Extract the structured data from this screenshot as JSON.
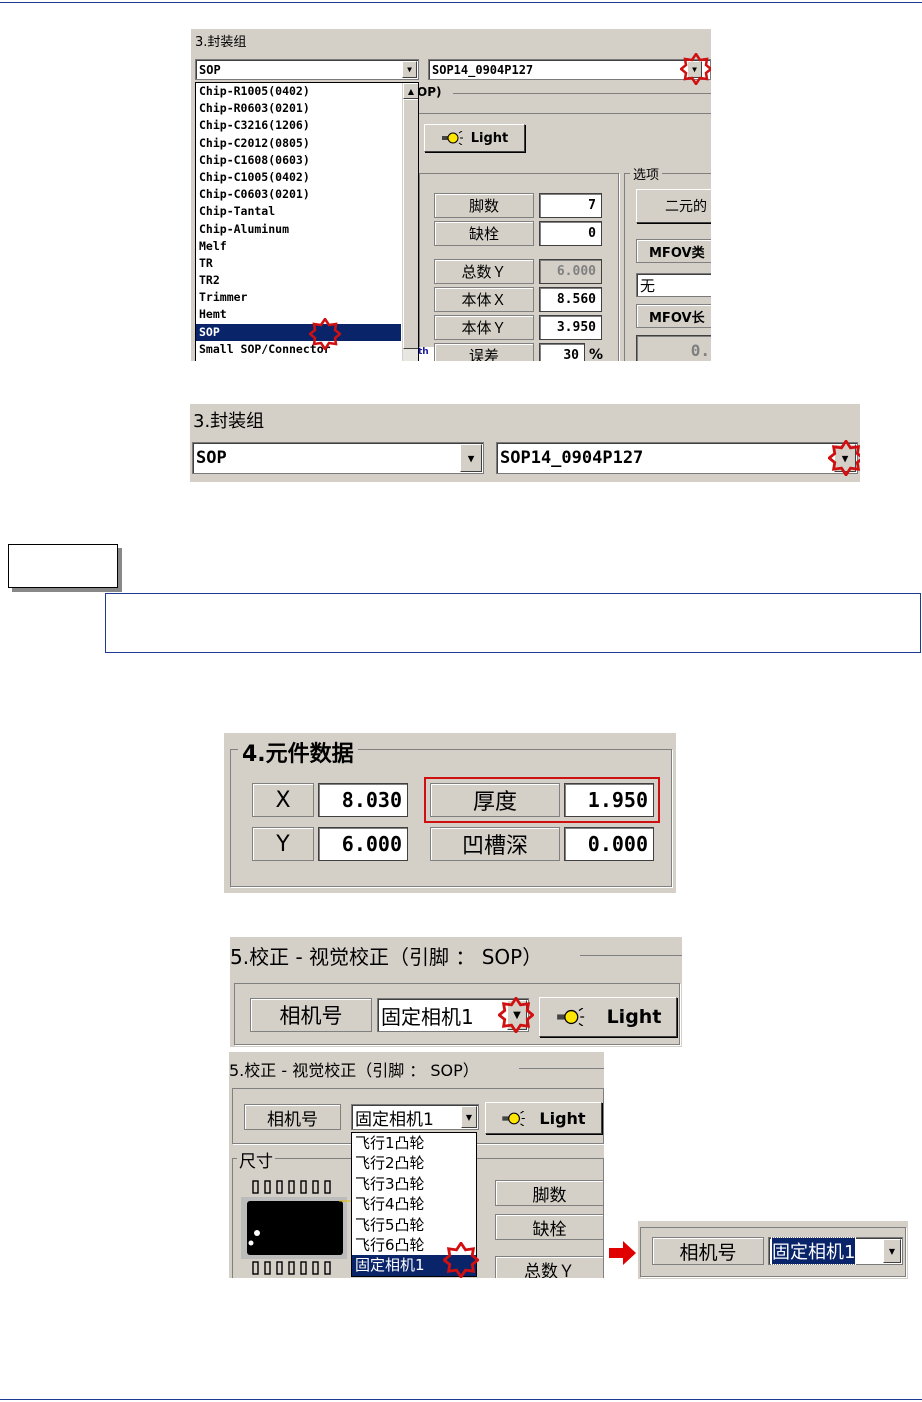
{
  "colors": {
    "accent_rule": "#1f3a93",
    "selection": "#0a246a",
    "panel": "#d4d0c8",
    "highlight_box": "#d01010"
  },
  "icons": [
    "light-bulb-icon",
    "dropdown-arrow-icon",
    "red-star-marker-icon",
    "red-arrow-right-icon",
    "scroll-up-arrow-icon"
  ],
  "shot1": {
    "group_title": "3.封装组",
    "type_combo": "SOP",
    "package_combo": "SOP14_0904P127",
    "list_items": [
      "Chip-R1005(0402)",
      "Chip-R0603(0201)",
      "Chip-C3216(1206)",
      "Chip-C2012(0805)",
      "Chip-C1608(0603)",
      "Chip-C1005(0402)",
      "Chip-C0603(0201)",
      "Chip-Tantal",
      "Chip-Aluminum",
      "Melf",
      "TR",
      "TR2",
      "Trimmer",
      "Hemt",
      "SOP",
      "Small SOP/Connector"
    ],
    "selected_item": "SOP",
    "partial_group": "OP)",
    "light_label": "Light",
    "options_title": "选项",
    "options_btn": "二元的",
    "mfov_type": "MFOV类",
    "mfov_combo": "无",
    "mfov_len": "MFOV长",
    "mfov_val": "0.",
    "fields": [
      {
        "label": "脚数",
        "value": "7"
      },
      {
        "label": "缺栓",
        "value": "0"
      },
      {
        "label": "总数Ｙ",
        "value": "6.000"
      },
      {
        "label": "本体Ｘ",
        "value": "8.560"
      },
      {
        "label": "本体Ｙ",
        "value": "3.950"
      },
      {
        "label": "误差",
        "value": "30",
        "unit": "%"
      }
    ],
    "side_tab": "th"
  },
  "shot2": {
    "group_title": "3.封装组",
    "type_combo": "SOP",
    "package_combo": "SOP14_0904P127"
  },
  "shot3": {
    "group_title": "4.元件数据",
    "rows": [
      {
        "l1": "X",
        "v1": "8.030",
        "l2": "厚度",
        "v2": "1.950"
      },
      {
        "l1": "Y",
        "v1": "6.000",
        "l2": "凹槽深",
        "v2": "0.000"
      }
    ]
  },
  "shot4": {
    "group_title": "5.校正 - 视觉校正（引脚 ： SOP）",
    "camera_label": "相机号",
    "camera_combo": "固定相机1",
    "light_label": "Light"
  },
  "shot5": {
    "group_title": "5.校正 - 视觉校正（引脚 ： SOP）",
    "camera_label": "相机号",
    "camera_combo": "固定相机1",
    "light_label": "Light",
    "size_title": "尺寸",
    "options": [
      "飞行1凸轮",
      "飞行2凸轮",
      "飞行3凸轮",
      "飞行4凸轮",
      "飞行5凸轮",
      "飞行6凸轮",
      "固定相机1"
    ],
    "selected_option": "固定相机1",
    "side_labels": [
      "脚数",
      "缺栓",
      "总数Ｙ"
    ]
  },
  "shot6": {
    "camera_label": "相机号",
    "camera_combo": "固定相机1"
  }
}
